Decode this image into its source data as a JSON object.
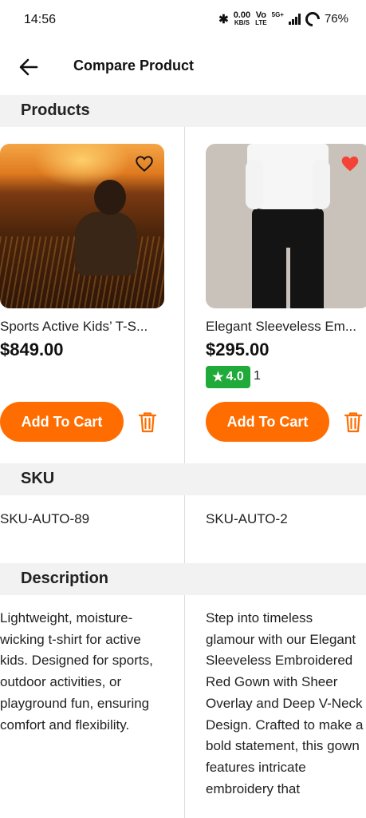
{
  "status_bar": {
    "time": "14:56",
    "net_speed_value": "0.00",
    "net_speed_unit": "KB/S",
    "volte_top": "Vo",
    "volte_bottom": "LTE",
    "network": "5G+",
    "battery": "76%"
  },
  "app_bar": {
    "title": "Compare Product",
    "back_icon": "arrow-left-icon"
  },
  "sections": {
    "products": "Products",
    "sku": "SKU",
    "description": "Description"
  },
  "products": [
    {
      "name": "Sports Active Kids’ T-S...",
      "price": "$849.00",
      "favorited": false,
      "cart_label": "Add To Cart",
      "sku": "SKU-AUTO-89",
      "description": "Lightweight, moisture-wicking t-shirt for active kids. Designed for sports, outdoor activities, or playground fun, ensuring comfort and flexibility."
    },
    {
      "name": "Elegant Sleeveless Em...",
      "price": "$295.00",
      "favorited": true,
      "rating": "4.0",
      "rating_count": "1",
      "cart_label": "Add To Cart",
      "sku": "SKU-AUTO-2",
      "description": "Step into timeless glamour with our Elegant Sleeveless Embroidered Red Gown with Sheer Overlay and Deep V-Neck Design. Crafted to make a bold statement, this gown features intricate embroidery that"
    }
  ],
  "colors": {
    "accent": "#ff6d00",
    "rating_green": "#1faa3a",
    "favorite_red": "#f44336",
    "section_bg": "#f2f2f2"
  }
}
